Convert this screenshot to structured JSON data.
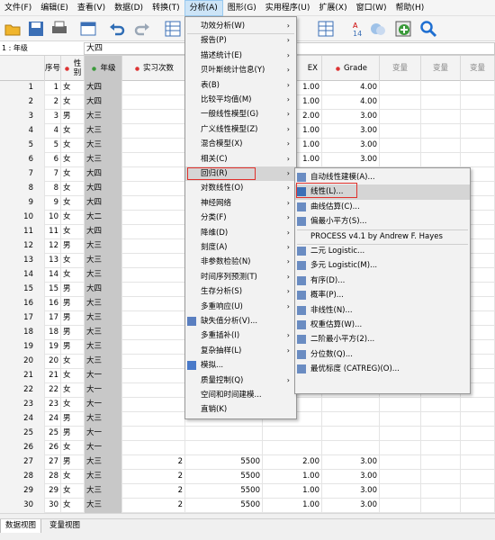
{
  "menubar": [
    "文件(F)",
    "编辑(E)",
    "查看(V)",
    "数据(D)",
    "转换(T)",
    "分析(A)",
    "图形(G)",
    "实用程序(U)",
    "扩展(X)",
    "窗口(W)",
    "帮助(H)"
  ],
  "cellbar": {
    "ref": "1 : 年级",
    "value": "大四"
  },
  "columns": {
    "no": "序号",
    "sex": "性别",
    "grade": "年级",
    "intern": "实习次数",
    "ex": "EX",
    "gr": "Grade",
    "var": "变量"
  },
  "rows": [
    {
      "n": "1",
      "no": "1",
      "sex": "女",
      "grade": "大四",
      "i": "",
      "ex": "",
      "ex2": "1.00",
      "gr": "4.00"
    },
    {
      "n": "2",
      "no": "2",
      "sex": "女",
      "grade": "大四",
      "i": "",
      "ex": "",
      "ex2": "1.00",
      "gr": "4.00"
    },
    {
      "n": "3",
      "no": "3",
      "sex": "男",
      "grade": "大三",
      "i": "",
      "ex": "",
      "ex2": "2.00",
      "gr": "3.00"
    },
    {
      "n": "4",
      "no": "4",
      "sex": "女",
      "grade": "大三",
      "i": "",
      "ex": "",
      "ex2": "1.00",
      "gr": "3.00"
    },
    {
      "n": "5",
      "no": "5",
      "sex": "女",
      "grade": "大三",
      "i": "",
      "ex": "",
      "ex2": "1.00",
      "gr": "3.00"
    },
    {
      "n": "6",
      "no": "6",
      "sex": "女",
      "grade": "大三",
      "i": "",
      "ex": "",
      "ex2": "1.00",
      "gr": "3.00"
    },
    {
      "n": "7",
      "no": "7",
      "sex": "女",
      "grade": "大四",
      "i": "",
      "ex": "",
      "ex2": "1.00",
      "gr": "4.00"
    },
    {
      "n": "8",
      "no": "8",
      "sex": "女",
      "grade": "大四",
      "i": "",
      "ex": "",
      "ex2": "",
      "gr": ""
    },
    {
      "n": "9",
      "no": "9",
      "sex": "女",
      "grade": "大四",
      "i": "",
      "ex": "",
      "ex2": "",
      "gr": ""
    },
    {
      "n": "10",
      "no": "10",
      "sex": "女",
      "grade": "大二",
      "i": "",
      "ex": "",
      "ex2": "",
      "gr": ""
    },
    {
      "n": "11",
      "no": "11",
      "sex": "女",
      "grade": "大四",
      "i": "",
      "ex": "",
      "ex2": "",
      "gr": ""
    },
    {
      "n": "12",
      "no": "12",
      "sex": "男",
      "grade": "大三",
      "i": "",
      "ex": "",
      "ex2": "",
      "gr": ""
    },
    {
      "n": "13",
      "no": "13",
      "sex": "女",
      "grade": "大三",
      "i": "",
      "ex": "",
      "ex2": "",
      "gr": ""
    },
    {
      "n": "14",
      "no": "14",
      "sex": "女",
      "grade": "大三",
      "i": "",
      "ex": "",
      "ex2": "",
      "gr": ""
    },
    {
      "n": "15",
      "no": "15",
      "sex": "男",
      "grade": "大四",
      "i": "",
      "ex": "",
      "ex2": "",
      "gr": ""
    },
    {
      "n": "16",
      "no": "16",
      "sex": "男",
      "grade": "大三",
      "i": "",
      "ex": "",
      "ex2": "",
      "gr": ""
    },
    {
      "n": "17",
      "no": "17",
      "sex": "男",
      "grade": "大三",
      "i": "",
      "ex": "",
      "ex2": "",
      "gr": ""
    },
    {
      "n": "18",
      "no": "18",
      "sex": "男",
      "grade": "大三",
      "i": "",
      "ex": "",
      "ex2": "",
      "gr": ""
    },
    {
      "n": "19",
      "no": "19",
      "sex": "男",
      "grade": "大三",
      "i": "",
      "ex": "",
      "ex2": "",
      "gr": ""
    },
    {
      "n": "20",
      "no": "20",
      "sex": "女",
      "grade": "大三",
      "i": "",
      "ex": "",
      "ex2": "",
      "gr": ""
    },
    {
      "n": "21",
      "no": "21",
      "sex": "女",
      "grade": "大一",
      "i": "",
      "ex": "",
      "ex2": "",
      "gr": ""
    },
    {
      "n": "22",
      "no": "22",
      "sex": "女",
      "grade": "大一",
      "i": "",
      "ex": "",
      "ex2": "",
      "gr": ""
    },
    {
      "n": "23",
      "no": "23",
      "sex": "女",
      "grade": "大一",
      "i": "",
      "ex": "",
      "ex2": "",
      "gr": ""
    },
    {
      "n": "24",
      "no": "24",
      "sex": "男",
      "grade": "大三",
      "i": "",
      "ex": "",
      "ex2": "",
      "gr": ""
    },
    {
      "n": "25",
      "no": "25",
      "sex": "男",
      "grade": "大一",
      "i": "",
      "ex": "",
      "ex2": "",
      "gr": ""
    },
    {
      "n": "26",
      "no": "26",
      "sex": "女",
      "grade": "大一",
      "i": "",
      "ex": "",
      "ex2": "",
      "gr": ""
    },
    {
      "n": "27",
      "no": "27",
      "sex": "男",
      "grade": "大三",
      "i": "2",
      "ex": "5500",
      "ex2": "2.00",
      "gr": "3.00"
    },
    {
      "n": "28",
      "no": "28",
      "sex": "女",
      "grade": "大三",
      "i": "2",
      "ex": "5500",
      "ex2": "1.00",
      "gr": "3.00"
    },
    {
      "n": "29",
      "no": "29",
      "sex": "女",
      "grade": "大三",
      "i": "2",
      "ex": "5500",
      "ex2": "1.00",
      "gr": "3.00"
    },
    {
      "n": "30",
      "no": "30",
      "sex": "女",
      "grade": "大三",
      "i": "2",
      "ex": "5500",
      "ex2": "1.00",
      "gr": "3.00"
    },
    {
      "n": "31",
      "no": "31",
      "sex": "女",
      "grade": "大三",
      "i": "1",
      "ex": "5500",
      "ex2": "1.00",
      "gr": "3.00"
    },
    {
      "n": "32",
      "no": "32",
      "sex": "女",
      "grade": "大二",
      "i": "2",
      "ex": "5500",
      "ex2": "1.00",
      "gr": "2.00"
    },
    {
      "n": "33",
      "no": "33",
      "sex": "女",
      "grade": "大二",
      "i": "",
      "ex": "",
      "ex2": "",
      "gr": ""
    }
  ],
  "tabs": {
    "data_view": "数据视图",
    "var_view": "变量视图"
  },
  "menu_analyze": [
    "功效分析(W)",
    "报告(P)",
    "描述统计(E)",
    "贝叶斯统计信息(Y)",
    "表(B)",
    "比较平均值(M)",
    "一般线性模型(G)",
    "广义线性模型(Z)",
    "混合模型(X)",
    "相关(C)",
    "回归(R)",
    "对数线性(O)",
    "神经网络",
    "分类(F)",
    "降维(D)",
    "刻度(A)",
    "非参数检验(N)",
    "时间序列预测(T)",
    "生存分析(S)",
    "多重响应(U)",
    "缺失值分析(V)...",
    "多重插补(I)",
    "复杂抽样(L)",
    "模拟...",
    "质量控制(Q)",
    "空间和时间建模...",
    "直销(K)"
  ],
  "menu_regression": [
    "自动线性建模(A)...",
    "线性(L)...",
    "曲线估算(C)...",
    "偏最小平方(S)...",
    "PROCESS v4.1 by Andrew F. Hayes",
    "二元 Logistic...",
    "多元 Logistic(M)...",
    "有序(D)...",
    "概率(P)...",
    "非线性(N)...",
    "权重估算(W)...",
    "二阶最小平方(2)...",
    "分位数(Q)...",
    "最优标度 (CATREG)(O)..."
  ],
  "colors": {
    "highlight_box": "#e0302b",
    "grade_column": "#c8c8c8"
  }
}
